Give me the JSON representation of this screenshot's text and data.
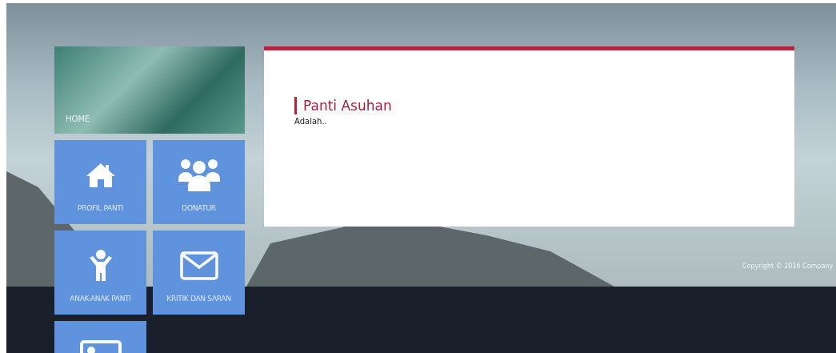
{
  "sidebar": {
    "home": {
      "label": "HOME"
    },
    "tiles": [
      {
        "kind": "house",
        "label": "PROFIL PANTI"
      },
      {
        "kind": "people",
        "label": "DONATUR"
      },
      {
        "kind": "child",
        "label": "ANAK-ANAK PANTI"
      },
      {
        "kind": "envelope",
        "label": "KRITIK DAN SARAN"
      },
      {
        "kind": "picture"
      }
    ]
  },
  "content": {
    "title": "Panti Asuhan",
    "text": "Adalah.."
  },
  "footer": {
    "copyright": "Copyright © 2016 Company"
  }
}
